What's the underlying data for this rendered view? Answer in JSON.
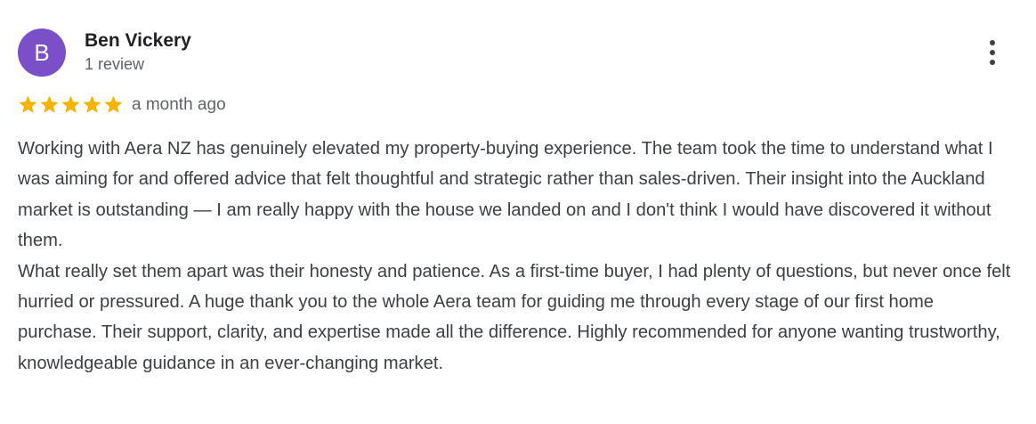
{
  "reviewer": {
    "initial": "B",
    "name": "Ben Vickery",
    "review_count": "1 review",
    "avatar_color": "#7b4fc8"
  },
  "review": {
    "rating": 5,
    "rating_max": 5,
    "star_color": "#f4b400",
    "time": "a month ago",
    "paragraphs": [
      "Working with Aera NZ has genuinely elevated my property-buying experience. The team took the time to understand what I was aiming for and offered advice that felt thoughtful and strategic rather than sales-driven. Their insight into the Auckland market is outstanding — I am really happy with the house we landed on and I don't think I would have discovered it without them.",
      "What really set them apart was their honesty and patience. As a first-time buyer, I had plenty of questions, but never once felt hurried or pressured. A huge thank you to the whole Aera team for guiding me through every stage of our first home purchase. Their support, clarity, and expertise made all the difference. Highly recommended for anyone wanting trustworthy, knowledgeable guidance in an ever-changing market."
    ]
  },
  "menu": {
    "icon": "more-vertical-icon"
  }
}
